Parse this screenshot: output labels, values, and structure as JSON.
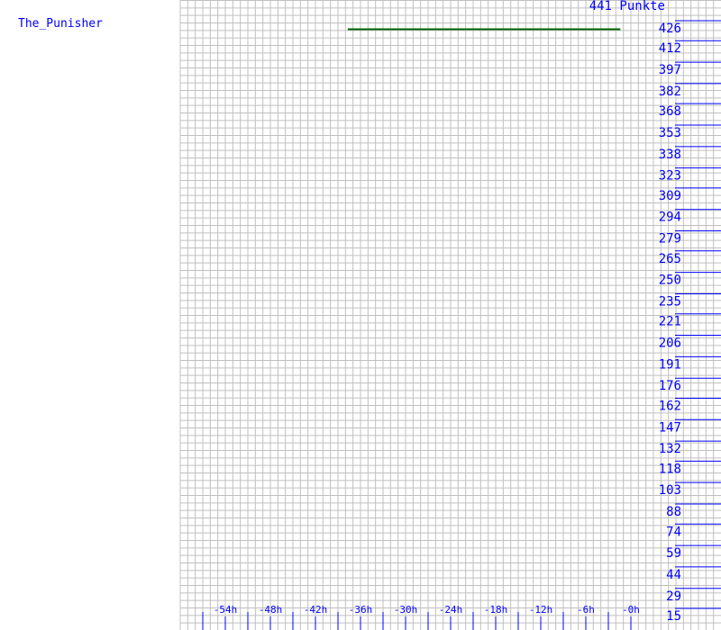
{
  "player_name": "The_Punisher",
  "chart_data": {
    "type": "line",
    "title": "441 Punkte",
    "xlabel": "",
    "ylabel": "",
    "x_ticks": [
      "-54h",
      "-48h",
      "-42h",
      "-36h",
      "-30h",
      "-24h",
      "-18h",
      "-12h",
      "-6h",
      "-0h"
    ],
    "x_tick_values": [
      -54,
      -48,
      -42,
      -36,
      -30,
      -24,
      -18,
      -12,
      -6,
      0
    ],
    "y_ticks": [
      426,
      412,
      397,
      382,
      368,
      353,
      338,
      323,
      309,
      294,
      279,
      265,
      250,
      235,
      221,
      206,
      191,
      176,
      162,
      147,
      132,
      118,
      103,
      88,
      74,
      59,
      44,
      29,
      15
    ],
    "xlim": [
      -60,
      0
    ],
    "ylim": [
      15,
      441
    ],
    "grid": true,
    "series": [
      {
        "x": [
          -37.7,
          -1.4
        ],
        "y": [
          420,
          420
        ],
        "color": "#006400"
      }
    ],
    "colors": {
      "grid": "#c0c0c0",
      "axis": "#0000ff",
      "line": "#006400"
    }
  }
}
